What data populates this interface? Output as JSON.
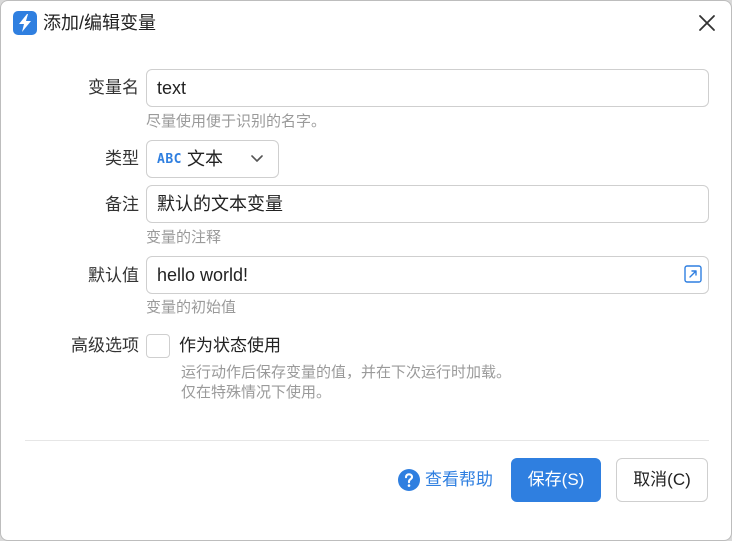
{
  "dialog": {
    "title": "添加/编辑变量",
    "app_icon": "lightning-bolt-icon",
    "close_icon": "close-icon"
  },
  "form": {
    "name": {
      "label": "变量名",
      "value": "text",
      "hint": "尽量使用便于识别的名字。"
    },
    "type": {
      "label": "类型",
      "icon_text": "ABC",
      "selected": "文本",
      "icon": "chevron-down-icon"
    },
    "note": {
      "label": "备注",
      "value": "默认的文本变量",
      "hint": "变量的注释"
    },
    "default": {
      "label": "默认值",
      "value": "hello world!",
      "hint": "变量的初始值",
      "icon": "expand-editor-icon"
    },
    "advanced": {
      "label": "高级选项",
      "checkbox_label": "作为状态使用",
      "checked": false,
      "hint_line1": "运行动作后保存变量的值，并在下次运行时加载。",
      "hint_line2": "仅在特殊情况下使用。"
    }
  },
  "footer": {
    "help_label": "查看帮助",
    "help_icon": "question-circle-icon",
    "save_label": "保存(S)",
    "cancel_label": "取消(C)"
  },
  "colors": {
    "accent": "#2f7fe0",
    "hint": "#9a9a9a",
    "border": "#cfcfcf"
  }
}
